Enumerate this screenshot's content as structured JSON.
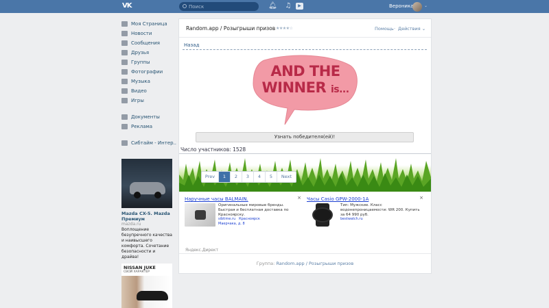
{
  "header": {
    "logo": "VK",
    "search_placeholder": "Поиск",
    "user_name": "Вероника",
    "icons": [
      "bell-icon",
      "music-icon",
      "play-icon"
    ]
  },
  "sidebar": {
    "items": [
      {
        "label": "Моя Страница",
        "icon": "home-icon"
      },
      {
        "label": "Новости",
        "icon": "news-icon"
      },
      {
        "label": "Сообщения",
        "icon": "messages-icon"
      },
      {
        "label": "Друзья",
        "icon": "friends-icon"
      },
      {
        "label": "Группы",
        "icon": "groups-icon"
      },
      {
        "label": "Фотографии",
        "icon": "camera-icon"
      },
      {
        "label": "Музыка",
        "icon": "music-icon"
      },
      {
        "label": "Видео",
        "icon": "video-icon"
      },
      {
        "label": "Игры",
        "icon": "games-icon"
      }
    ],
    "items2": [
      {
        "label": "Документы",
        "icon": "documents-icon"
      },
      {
        "label": "Реклама",
        "icon": "ads-icon"
      }
    ],
    "items3": [
      {
        "label": "Сибтайм - Интер..",
        "icon": "group-icon"
      }
    ],
    "ad": {
      "title": "Mazda CX-5. Mazda Премиум",
      "source": "mazda.ru",
      "description": "Воплощение безупречного качества и наивысшего комфорта. Сочетание безопасности и драйва!"
    },
    "ad2": {
      "title": "NISSAN JUKE",
      "subtitle": "СВОЙ ХАРАКТЕР"
    }
  },
  "main": {
    "app_title": "Random.app / Розыгрыши призов",
    "stars": "★★★★☆",
    "help": "Помощь",
    "separator": "·",
    "actions": "Действия ⌄",
    "back": "Назад",
    "banner_line1": "AND THE",
    "banner_line2": "WINNER",
    "banner_line2_suffix": "is...",
    "winner_button": "Узнать победителя(ей)!",
    "participants": "Число участников: 1528",
    "pagination": {
      "prev": "Prev",
      "pages": [
        "1",
        "2",
        "3",
        "4",
        "5"
      ],
      "active": "1",
      "next": "Next"
    },
    "direct_ads": [
      {
        "title": "Наручные часы BALMAIN.",
        "text": "Оригинальные мировые бренды. Быстрая и бесплатная доставка по Красноярску.",
        "link": "sibtime.ru",
        "city": "Красноярск",
        "address": "Маерчака, д. 8",
        "close": "×"
      },
      {
        "title": "Часы Casio GPW-2000-1A",
        "text": "Тип: Мужские. Класс водонепроницаемости: WR 200. Купить за 64 990 руб.",
        "link": "bestwatch.ru",
        "close": "×"
      }
    ],
    "yandex": "Яндекс.Директ",
    "footer_prefix": "Группа: ",
    "footer_group": "Random.app / Розыгрыши призов"
  }
}
